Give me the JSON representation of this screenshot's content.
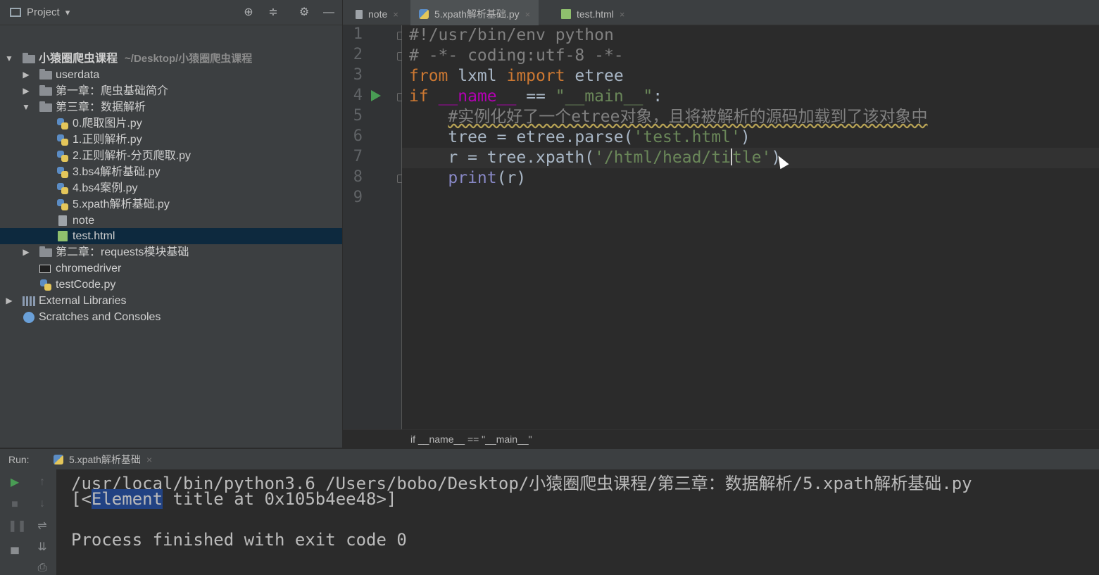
{
  "project": {
    "title": "Project",
    "dropdown_glyph": "▾",
    "toolbar_icons": [
      "locate-icon",
      "collapse-icon",
      "gear-icon",
      "minimize-icon"
    ],
    "root": {
      "name": "小猿圈爬虫课程",
      "path": "~/Desktop/小猿圈爬虫课程"
    },
    "items": [
      {
        "label": "userdata",
        "type": "folder"
      },
      {
        "label": "第一章：爬虫基础简介",
        "type": "folder"
      },
      {
        "label": "第三章：数据解析",
        "type": "folder"
      },
      {
        "label": "0.爬取图片.py",
        "type": "python"
      },
      {
        "label": "1.正则解析.py",
        "type": "python"
      },
      {
        "label": "2.正则解析-分页爬取.py",
        "type": "python"
      },
      {
        "label": "3.bs4解析基础.py",
        "type": "python"
      },
      {
        "label": "4.bs4案例.py",
        "type": "python"
      },
      {
        "label": "5.xpath解析基础.py",
        "type": "python"
      },
      {
        "label": "note",
        "type": "text"
      },
      {
        "label": "test.html",
        "type": "html",
        "selected": true
      },
      {
        "label": "第二章：requests模块基础",
        "type": "folder"
      },
      {
        "label": "chromedriver",
        "type": "executable"
      },
      {
        "label": "testCode.py",
        "type": "python"
      },
      {
        "label": "External Libraries",
        "type": "libraries"
      },
      {
        "label": "Scratches and Consoles",
        "type": "scratches"
      }
    ]
  },
  "editor": {
    "tabs": [
      {
        "label": "note",
        "close": "×"
      },
      {
        "label": "5.xpath解析基础.py",
        "close": "×",
        "active": true
      },
      {
        "label": "test.html",
        "close": "×"
      }
    ],
    "line_numbers": [
      "1",
      "2",
      "3",
      "4",
      "5",
      "6",
      "7",
      "8",
      "9"
    ],
    "code": {
      "l1": "#!/usr/bin/env python",
      "l2": "# -*- coding:utf-8 -*-",
      "l3_from": "from",
      "l3_mod": " lxml ",
      "l3_import": "import",
      "l3_rest": " etree",
      "l4_if": "if",
      "l4_name": "__name__",
      "l4_eq": " == ",
      "l4_main": "\"__main__\"",
      "l4_colon": ":",
      "l5_comment": "#实例化好了一个etree对象，且将被解析的源码加载到了该对象中",
      "l6_pre": "tree = etree.parse(",
      "l6_str": "'test.html'",
      "l6_post": ")",
      "l7_pre": "r = tree.xpath(",
      "l7_str_a": "'/html/head/ti",
      "l7_str_b": "tle'",
      "l7_post": ")",
      "l8_fn": "print",
      "l8_rest": "(r)"
    },
    "breadcrumb": "if __name__ == \"__main__\""
  },
  "run": {
    "label": "Run:",
    "tab": "5.xpath解析基础",
    "tab_close": "×",
    "console": {
      "cmd": "/usr/local/bin/python3.6 /Users/bobo/Desktop/小猿圈爬虫课程/第三章：数据解析/5.xpath解析基础.py",
      "out_pre": "[<",
      "out_hl": "Element",
      "out_post": " title at 0x105b4ee48>]",
      "exit": "Process finished with exit code 0"
    },
    "toolbar_icons": [
      "run-icon",
      "up-icon",
      "stop-icon",
      "down-icon",
      "pause-icon",
      "soft-wrap-icon",
      "scroll-end-icon",
      "layout-icon",
      "print-icon"
    ]
  },
  "colors": {
    "keyword": "#cc7832",
    "string": "#6a8759",
    "comment": "#808080",
    "dunder": "#b200b2",
    "selection": "#0d293e"
  }
}
